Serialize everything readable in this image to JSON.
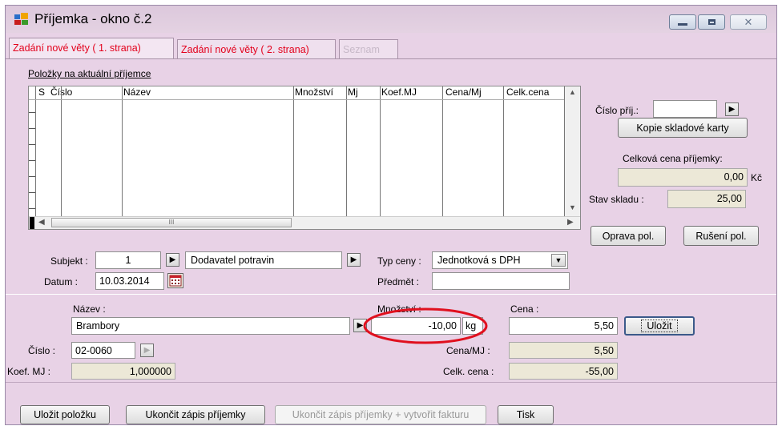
{
  "window": {
    "title": "Příjemka - okno č.2",
    "tabs": [
      {
        "label": "Zadání nové věty ( 1. strana)"
      },
      {
        "label": "Zadání nové věty ( 2. strana)"
      },
      {
        "label": "Seznam"
      }
    ]
  },
  "grid": {
    "caption": "Položky na aktuální příjemce",
    "columns": [
      "S",
      "Číslo",
      "Název",
      "Množství",
      "Mj",
      "Koef.MJ",
      "Cena/Mj",
      "Celk.cena"
    ],
    "hscroll_thumb": "III"
  },
  "right_panel": {
    "cislo_prij_label": "Číslo příj.:",
    "cislo_prij_value": "",
    "kopie_button": "Kopie skladové karty",
    "celkova_label": "Celková cena příjemky:",
    "celkova_value": "0,00",
    "currency": "Kč",
    "stav_label": "Stav skladu :",
    "stav_value": "25,00",
    "oprava_button": "Oprava pol.",
    "ruseni_button": "Rušení pol."
  },
  "header_fields": {
    "subjekt_label": "Subjekt :",
    "subjekt_value": "1",
    "dodavatel_value": "Dodavatel potravin",
    "typ_ceny_label": "Typ ceny :",
    "typ_ceny_value": "Jednotková s DPH",
    "datum_label": "Datum :",
    "datum_value": "10.03.2014",
    "predmet_label": "Předmět :",
    "predmet_value": ""
  },
  "item": {
    "nazev_label": "Název :",
    "nazev_value": "Brambory",
    "mnozstvi_label": "Množství :",
    "mnozstvi_value": "-10,00",
    "mnozstvi_unit": "kg",
    "cena_label": "Cena :",
    "cena_value": "5,50",
    "ulozit_button": "Uložit",
    "cislo_label": "Číslo :",
    "cislo_value": "02-0060",
    "cena_mj_label": "Cena/MJ :",
    "cena_mj_value": "5,50",
    "koef_label": "Koef. MJ :",
    "koef_value": "1,000000",
    "celk_cena_label": "Celk. cena :",
    "celk_cena_value": "-55,00"
  },
  "footer": {
    "ulozit_polozku": "Uložit položku",
    "ukoncit_zapis": "Ukončit zápis příjemky",
    "ukoncit_faktura": "Ukončit zápis příjemky + vytvořit fakturu",
    "tisk": "Tisk"
  },
  "colors": {
    "window_bg": "#e8d2e6",
    "tab_text": "#e3001b",
    "highlight_ellipse": "#e0101e"
  }
}
